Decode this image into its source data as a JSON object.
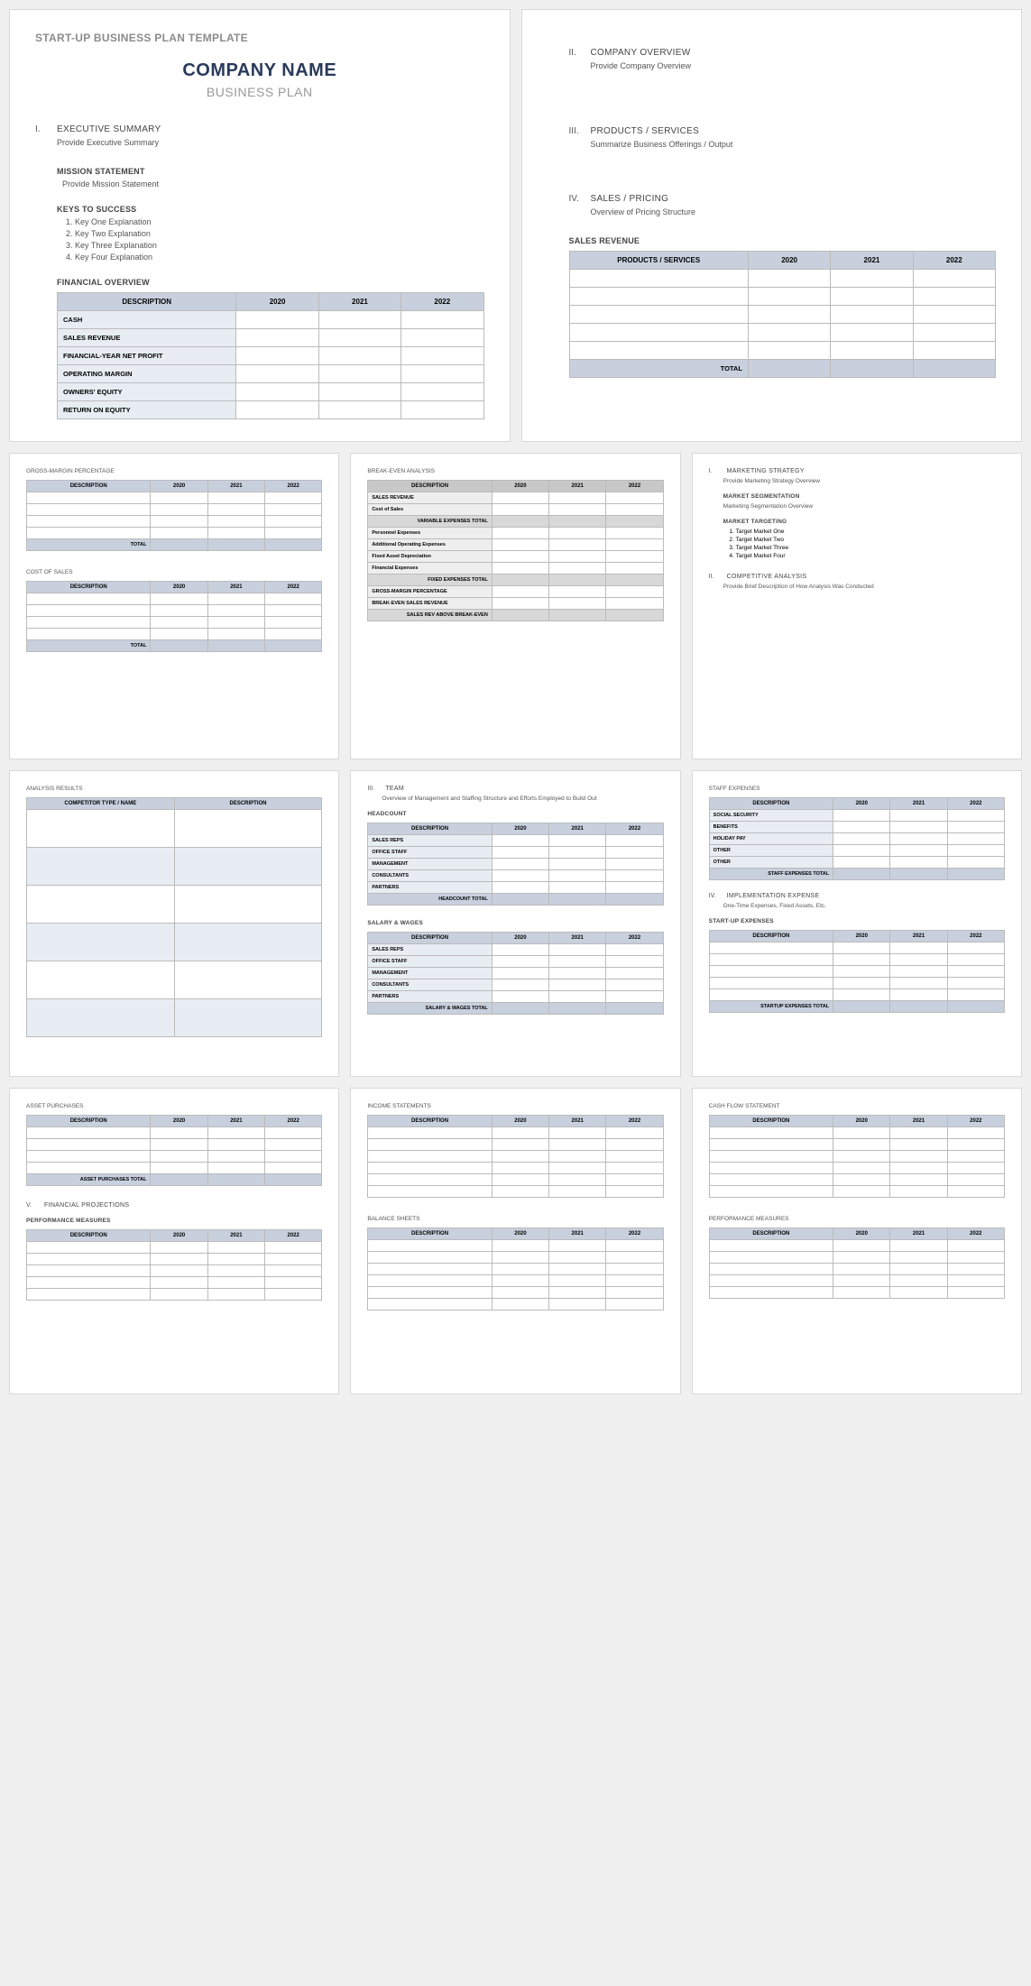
{
  "p1": {
    "template": "START-UP BUSINESS PLAN TEMPLATE",
    "company": "COMPANY NAME",
    "subtitle": "BUSINESS PLAN",
    "s1": {
      "num": "I.",
      "title": "EXECUTIVE SUMMARY",
      "body": "Provide Executive Summary"
    },
    "mission": {
      "h": "MISSION STATEMENT",
      "body": "Provide Mission Statement"
    },
    "keys": {
      "h": "KEYS TO SUCCESS",
      "items": [
        "Key One Explanation",
        "Key Two Explanation",
        "Key Three Explanation",
        "Key Four Explanation"
      ]
    },
    "fin": {
      "h": "FINANCIAL OVERVIEW",
      "cols": [
        "DESCRIPTION",
        "2020",
        "2021",
        "2022"
      ],
      "rows": [
        "CASH",
        "SALES REVENUE",
        "FINANCIAL-YEAR NET PROFIT",
        "OPERATING MARGIN",
        "OWNERS' EQUITY",
        "RETURN ON EQUITY"
      ]
    }
  },
  "p2": {
    "s2": {
      "num": "II.",
      "title": "COMPANY OVERVIEW",
      "body": "Provide Company Overview"
    },
    "s3": {
      "num": "III.",
      "title": "PRODUCTS / SERVICES",
      "body": "Summarize Business Offerings / Output"
    },
    "s4": {
      "num": "IV.",
      "title": "SALES / PRICING",
      "body": "Overview of Pricing Structure"
    },
    "rev": {
      "h": "SALES REVENUE",
      "cols": [
        "PRODUCTS / SERVICES",
        "2020",
        "2021",
        "2022"
      ],
      "blank": 5,
      "total": "TOTAL"
    }
  },
  "p3": {
    "gmp": {
      "h": "GROSS-MARGIN PERCENTAGE",
      "cols": [
        "DESCRIPTION",
        "2020",
        "2021",
        "2022"
      ],
      "blank": 4,
      "total": "TOTAL"
    },
    "cos": {
      "h": "COST OF SALES",
      "cols": [
        "DESCRIPTION",
        "2020",
        "2021",
        "2022"
      ],
      "blank": 4,
      "total": "TOTAL"
    }
  },
  "p4": {
    "bea": {
      "h": "BREAK-EVEN ANALYSIS",
      "cols": [
        "DESCRIPTION",
        "2020",
        "2021",
        "2022"
      ],
      "rows1": [
        "SALES REVENUE",
        "Cost of Sales"
      ],
      "sub1": "VARIABLE EXPENSES TOTAL",
      "rows2": [
        "Personnel Expenses",
        "Additional Operating Expenses",
        "Fixed Asset Depreciation",
        "Financial Expenses"
      ],
      "sub2": "FIXED EXPENSES TOTAL",
      "rows3": [
        "GROSS-MARGIN PERCENTAGE",
        "BREAK-EVEN SALES REVENUE"
      ],
      "sub3": "SALES REV ABOVE BREAK-EVEN"
    }
  },
  "p5": {
    "s1": {
      "num": "I.",
      "title": "MARKETING STRATEGY",
      "body": "Provide Marketing Strategy Overview"
    },
    "seg": {
      "h": "MARKET SEGMENTATION",
      "body": "Marketing Segmentation Overview"
    },
    "tgt": {
      "h": "MARKET TARGETING",
      "items": [
        "Target Market One",
        "Target Market Two",
        "Target Market Three",
        "Target Market Four"
      ]
    },
    "s2": {
      "num": "II.",
      "title": "COMPETITIVE ANALYSIS",
      "body": "Provide Brief Description of How Analysis Was Conducted"
    }
  },
  "p6": {
    "ar": {
      "h": "ANALYSIS RESULTS",
      "cols": [
        "COMPETITOR TYPE / NAME",
        "DESCRIPTION"
      ],
      "blank": 6
    }
  },
  "p7": {
    "s3": {
      "num": "III.",
      "title": "TEAM",
      "body": "Overview of Management and Staffing Structure and Efforts Employed to Build Out"
    },
    "hc": {
      "h": "HEADCOUNT",
      "cols": [
        "DESCRIPTION",
        "2020",
        "2021",
        "2022"
      ],
      "rows": [
        "SALES REPS",
        "OFFICE STAFF",
        "MANAGEMENT",
        "CONSULTANTS",
        "PARTNERS"
      ],
      "total": "HEADCOUNT TOTAL"
    },
    "sw": {
      "h": "SALARY & WAGES",
      "cols": [
        "DESCRIPTION",
        "2020",
        "2021",
        "2022"
      ],
      "rows": [
        "SALES REPS",
        "OFFICE STAFF",
        "MANAGEMENT",
        "CONSULTANTS",
        "PARTNERS"
      ],
      "total": "SALARY & WAGES TOTAL"
    }
  },
  "p8": {
    "se": {
      "h": "STAFF EXPENSES",
      "cols": [
        "DESCRIPTION",
        "2020",
        "2021",
        "2022"
      ],
      "rows": [
        "SOCIAL SECURITY",
        "BENEFITS",
        "HOLIDAY PAY",
        "OTHER",
        "OTHER"
      ],
      "total": "STAFF EXPENSES TOTAL"
    },
    "s4": {
      "num": "IV.",
      "title": "IMPLEMENTATION EXPENSE",
      "body": "One-Time Expenses, Fixed Assets, Etc."
    },
    "su": {
      "h": "START-UP EXPENSES",
      "cols": [
        "DESCRIPTION",
        "2020",
        "2021",
        "2022"
      ],
      "blank": 5,
      "total": "STARTUP EXPENSES TOTAL"
    }
  },
  "p9": {
    "ap": {
      "h": "ASSET PURCHASES",
      "cols": [
        "DESCRIPTION",
        "2020",
        "2021",
        "2022"
      ],
      "blank": 4,
      "total": "ASSET PURCHASES TOTAL"
    },
    "s5": {
      "num": "V.",
      "title": "FINANCIAL PROJECTIONS"
    },
    "pm": {
      "h": "PERFORMANCE MEASURES",
      "cols": [
        "DESCRIPTION",
        "2020",
        "2021",
        "2022"
      ],
      "blank": 5
    }
  },
  "p10": {
    "is": {
      "h": "INCOME STATEMENTS",
      "cols": [
        "DESCRIPTION",
        "2020",
        "2021",
        "2022"
      ],
      "blank": 6
    },
    "bs": {
      "h": "BALANCE SHEETS",
      "cols": [
        "DESCRIPTION",
        "2020",
        "2021",
        "2022"
      ],
      "blank": 6
    }
  },
  "p11": {
    "cf": {
      "h": "CASH FLOW STATEMENT",
      "cols": [
        "DESCRIPTION",
        "2020",
        "2021",
        "2022"
      ],
      "blank": 6
    },
    "pm": {
      "h": "PERFORMANCE MEASURES",
      "cols": [
        "DESCRIPTION",
        "2020",
        "2021",
        "2022"
      ],
      "blank": 5
    }
  }
}
